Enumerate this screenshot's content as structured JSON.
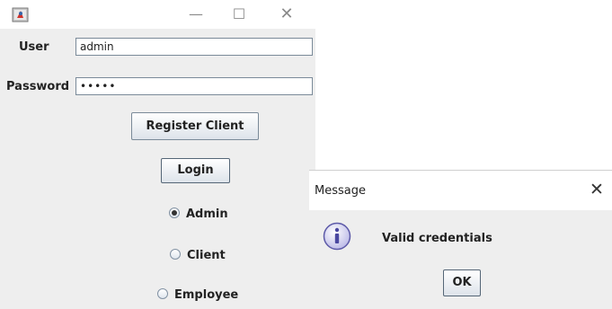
{
  "window": {
    "minimize_glyph": "—",
    "maximize_glyph": "☐",
    "close_glyph": "✕"
  },
  "form": {
    "user_label": "User",
    "user_value": "admin",
    "password_label": "Password",
    "password_value": "•••••",
    "register_button": "Register Client",
    "login_button": "Login"
  },
  "roles": [
    {
      "label": "Admin",
      "selected": true
    },
    {
      "label": "Client",
      "selected": false
    },
    {
      "label": "Employee",
      "selected": false
    }
  ],
  "dialog": {
    "title": "Message",
    "close_glyph": "✕",
    "message": "Valid credentials",
    "ok_button": "OK",
    "icon": "info-icon"
  }
}
